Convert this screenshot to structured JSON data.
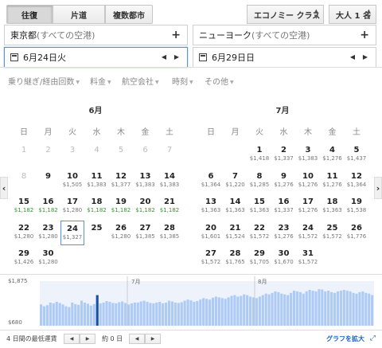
{
  "trip_types": {
    "round_trip": "往復",
    "one_way": "片道",
    "multi_city": "複数都市"
  },
  "cabin": {
    "value": "エコノミー クラス"
  },
  "passengers": {
    "value": "大人 1 名"
  },
  "origin": {
    "city": "東京都",
    "suffix": " (すべての空港)"
  },
  "destination": {
    "city": "ニューヨーク",
    "suffix": " (すべての空港)"
  },
  "depart_date": "6月24日火",
  "return_date": "6月29日日",
  "filters": [
    "乗り継ぎ/経由回数",
    "料金",
    "航空会社",
    "時刻",
    "その他"
  ],
  "weekdays": [
    "日",
    "月",
    "火",
    "水",
    "木",
    "金",
    "土"
  ],
  "months": [
    {
      "title": "6月",
      "rows": [
        [
          [
            "1",
            "",
            0
          ],
          [
            "2",
            "",
            0
          ],
          [
            "3",
            "",
            0
          ],
          [
            "4",
            "",
            0
          ],
          [
            "5",
            "",
            0
          ],
          [
            "6",
            "",
            0
          ],
          [
            "7",
            "",
            0
          ]
        ],
        [
          [
            "8",
            "",
            0
          ],
          [
            "9",
            "",
            1
          ],
          [
            "10",
            "$1,505",
            1
          ],
          [
            "11",
            "$1,383",
            1
          ],
          [
            "12",
            "$1,377",
            1
          ],
          [
            "13",
            "$1,383",
            1
          ],
          [
            "14",
            "$1,383",
            1
          ]
        ],
        [
          [
            "15",
            "$1,182",
            2
          ],
          [
            "16",
            "$1,182",
            2
          ],
          [
            "17",
            "$1,280",
            1
          ],
          [
            "18",
            "$1,182",
            2
          ],
          [
            "19",
            "$1,182",
            2
          ],
          [
            "20",
            "$1,182",
            2
          ],
          [
            "21",
            "$1,182",
            2
          ]
        ],
        [
          [
            "22",
            "$1,280",
            1
          ],
          [
            "23",
            "$1,280",
            1
          ],
          [
            "24",
            "$1,327",
            3
          ],
          [
            "25",
            "",
            1
          ],
          [
            "26",
            "$1,280",
            1
          ],
          [
            "27",
            "$1,385",
            1
          ],
          [
            "28",
            "$1,385",
            1
          ]
        ],
        [
          [
            "29",
            "$1,426",
            1
          ],
          [
            "30",
            "$1,280",
            1
          ]
        ]
      ]
    },
    {
      "title": "7月",
      "rows": [
        [
          null,
          null,
          [
            "1",
            "$1,418",
            1
          ],
          [
            "2",
            "$1,337",
            1
          ],
          [
            "3",
            "$1,383",
            1
          ],
          [
            "4",
            "$1,276",
            1
          ],
          [
            "5",
            "$1,437",
            1
          ]
        ],
        [
          [
            "6",
            "$1,364",
            1
          ],
          [
            "7",
            "$1,220",
            1
          ],
          [
            "8",
            "$1,285",
            1
          ],
          [
            "9",
            "$1,276",
            1
          ],
          [
            "10",
            "$1,276",
            1
          ],
          [
            "11",
            "$1,276",
            1
          ],
          [
            "12",
            "$1,364",
            1
          ]
        ],
        [
          [
            "13",
            "$1,363",
            1
          ],
          [
            "14",
            "$1,363",
            1
          ],
          [
            "15",
            "$1,363",
            1
          ],
          [
            "16",
            "$1,337",
            1
          ],
          [
            "17",
            "$1,276",
            1
          ],
          [
            "18",
            "$1,363",
            1
          ],
          [
            "19",
            "$1,538",
            1
          ]
        ],
        [
          [
            "20",
            "$1,601",
            1
          ],
          [
            "21",
            "$1,524",
            1
          ],
          [
            "22",
            "$1,572",
            1
          ],
          [
            "23",
            "$1,276",
            1
          ],
          [
            "24",
            "$1,572",
            1
          ],
          [
            "25",
            "$1,572",
            1
          ],
          [
            "26",
            "$1,776",
            1
          ]
        ],
        [
          [
            "27",
            "$1,572",
            1
          ],
          [
            "28",
            "$1,765",
            1
          ],
          [
            "29",
            "$1,705",
            1
          ],
          [
            "30",
            "$1,670",
            1
          ],
          [
            "31",
            "$1,572",
            1
          ]
        ]
      ]
    }
  ],
  "graph": {
    "max_label": "$1,875",
    "min_label": "$680",
    "month_labels": [
      "7月",
      "8月"
    ],
    "values": [
      1250,
      1200,
      1230,
      1300,
      1280,
      1320,
      1290,
      1250,
      1200,
      1180,
      1300,
      1260,
      1240,
      1350,
      1300,
      1270,
      1220,
      1260,
      1500,
      1280,
      1300,
      1340,
      1320,
      1290,
      1280,
      1310,
      1330,
      1290,
      1250,
      1280,
      1300,
      1300,
      1330,
      1350,
      1320,
      1290,
      1280,
      1300,
      1320,
      1280,
      1300,
      1350,
      1330,
      1300,
      1290,
      1310,
      1350,
      1380,
      1360,
      1320,
      1340,
      1380,
      1420,
      1400,
      1380,
      1430,
      1460,
      1440,
      1420,
      1400,
      1440,
      1480,
      1500,
      1460,
      1480,
      1520,
      1500,
      1460,
      1440,
      1420,
      1460,
      1500,
      1540,
      1520,
      1560,
      1600,
      1580,
      1540,
      1520,
      1500,
      1560,
      1620,
      1600,
      1580,
      1540,
      1600,
      1640,
      1620,
      1600,
      1660,
      1650,
      1600,
      1620,
      1580,
      1560,
      1600,
      1620,
      1640,
      1620,
      1600,
      1560,
      1540,
      1580,
      1600,
      1560,
      1540,
      1500
    ],
    "selected_index": 18
  },
  "bottom": {
    "label": "4 日間の最低運賃",
    "days": "約 0 日",
    "link": "グラフを拡大"
  },
  "colors": {
    "accent": "#4d90fe",
    "green": "#2a9d2a",
    "bar": "#aecbf5",
    "bar_sel": "#1a4fa8"
  }
}
